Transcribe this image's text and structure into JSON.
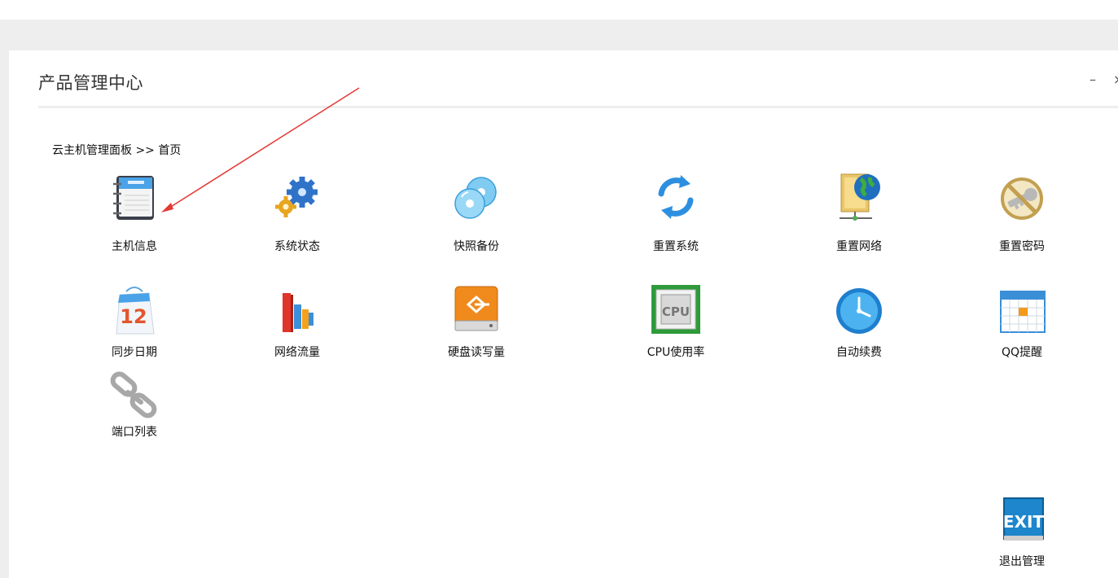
{
  "panel": {
    "title": "产品管理中心",
    "minimize_glyph": "–",
    "close_glyph": "×"
  },
  "breadcrumb": "云主机管理面板 >> 首页",
  "tiles": [
    {
      "label": "主机信息",
      "icon": "address-book-icon"
    },
    {
      "label": "系统状态",
      "icon": "gears-icon"
    },
    {
      "label": "快照备份",
      "icon": "discs-icon"
    },
    {
      "label": "重置系统",
      "icon": "refresh-icon"
    },
    {
      "label": "重置网络",
      "icon": "network-globe-icon"
    },
    {
      "label": "重置密码",
      "icon": "no-key-icon"
    },
    {
      "label": "同步日期",
      "icon": "calendar-bag-icon"
    },
    {
      "label": "网络流量",
      "icon": "bar-chart-icon"
    },
    {
      "label": "硬盘读写量",
      "icon": "hard-drive-icon"
    },
    {
      "label": "CPU使用率",
      "icon": "cpu-chip-icon"
    },
    {
      "label": "自动续费",
      "icon": "clock-icon"
    },
    {
      "label": "QQ提醒",
      "icon": "calendar-grid-icon"
    },
    {
      "label": "端口列表",
      "icon": "chain-link-icon"
    },
    {
      "label": "退出管理",
      "icon": "exit-sign-icon"
    }
  ],
  "calendar_day": "12",
  "cpu_text": "CPU",
  "exit_text": "EXIT",
  "colors": {
    "background_gray": "#eeeeee",
    "annotation_arrow": "#e53935"
  }
}
